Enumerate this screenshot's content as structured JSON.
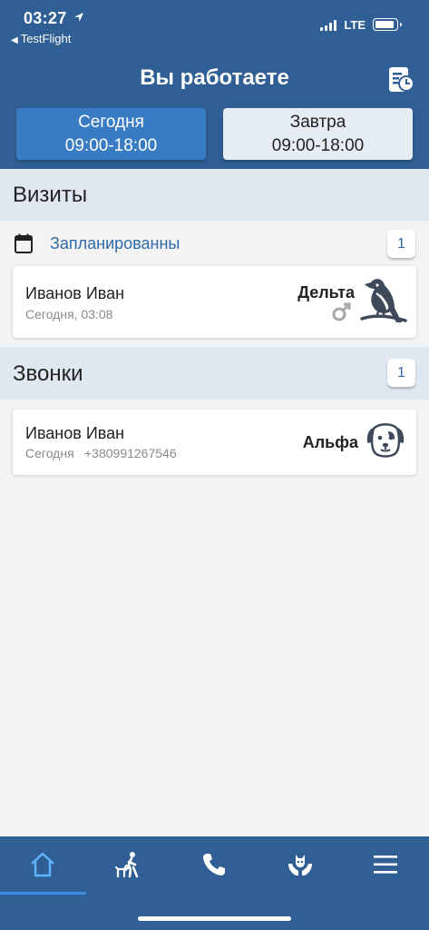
{
  "status_bar": {
    "time": "03:27",
    "back_app": "TestFlight",
    "network": "LTE"
  },
  "header": {
    "title": "Вы работаете"
  },
  "shifts": [
    {
      "day": "Сегодня",
      "hours": "09:00-18:00",
      "selected": true
    },
    {
      "day": "Завтра",
      "hours": "09:00-18:00",
      "selected": false
    }
  ],
  "visits": {
    "title": "Визиты",
    "group_label": "Запланированны",
    "count": "1",
    "items": [
      {
        "name": "Иванов Иван",
        "time": "Сегодня, 03:08",
        "pet": "Дельта",
        "species_icon": "bird-icon",
        "sex_icon": "male-icon"
      }
    ]
  },
  "calls": {
    "title": "Звонки",
    "count": "1",
    "items": [
      {
        "name": "Иванов Иван",
        "day": "Сегодня",
        "phone": "+380991267546",
        "pet": "Альфа",
        "species_icon": "dog-icon"
      }
    ]
  },
  "tabbar": {
    "items": [
      "home-icon",
      "walk-with-pet-icon",
      "phone-icon",
      "pet-care-icon",
      "menu-icon"
    ],
    "active": "home-icon"
  },
  "colors": {
    "header_bg": "#2f5f95",
    "accent": "#3a7cc4",
    "section_bg": "#dfe8f1",
    "link": "#2f6aa8"
  }
}
